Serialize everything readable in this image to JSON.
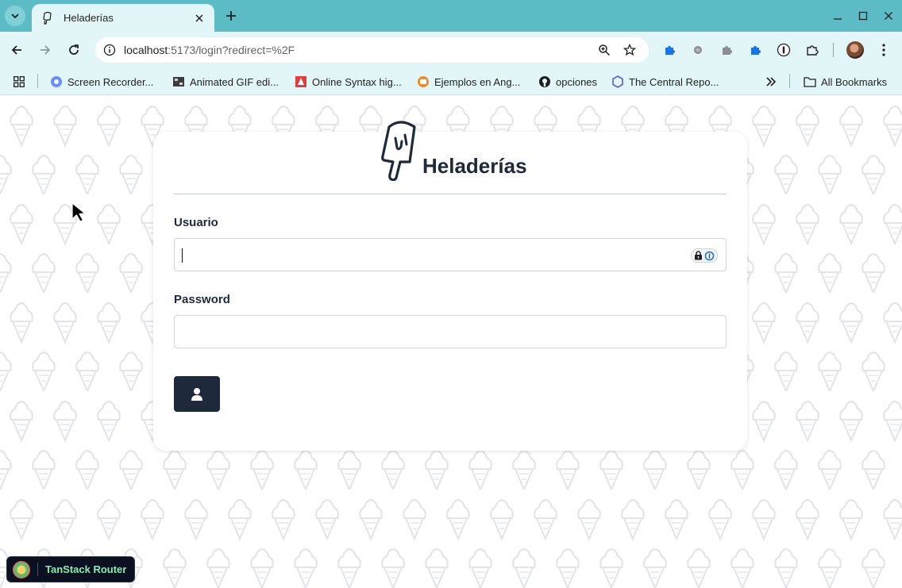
{
  "browser": {
    "tab": {
      "title": "Heladerías"
    },
    "address": {
      "host": "localhost",
      "path": ":5173/login?redirect=%2F"
    },
    "bookmarks": [
      {
        "label": "Screen Recorder..."
      },
      {
        "label": "Animated GIF edi..."
      },
      {
        "label": "Online Syntax hig..."
      },
      {
        "label": "Ejemplos en Ang..."
      },
      {
        "label": "opciones"
      },
      {
        "label": "The Central Repo..."
      }
    ],
    "all_bookmarks": "All Bookmarks"
  },
  "login": {
    "brand": "Heladerías",
    "username_label": "Usuario",
    "username_value": "",
    "password_label": "Password",
    "password_value": ""
  },
  "devtools": {
    "label": "TanStack Router"
  },
  "colors": {
    "tabstrip": "#5cbcc5",
    "toolbar": "#e3f6f7",
    "primary": "#1e2a3b",
    "pattern": "#e6e8eb"
  },
  "icons": {
    "tab_search": "chevron-down-icon",
    "back": "arrow-left-icon",
    "forward": "arrow-right-icon",
    "reload": "reload-icon",
    "site_info": "site-info-icon",
    "zoom": "zoom-icon",
    "bookmark": "star-icon",
    "login_button": "user-icon",
    "logo": "popsicle-icon"
  }
}
